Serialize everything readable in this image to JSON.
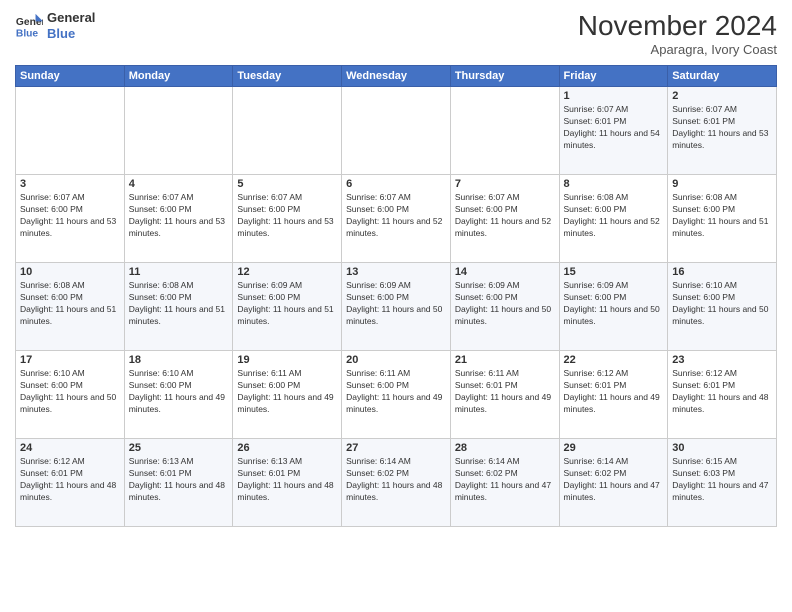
{
  "header": {
    "logo_line1": "General",
    "logo_line2": "Blue",
    "month": "November 2024",
    "location": "Aparagra, Ivory Coast"
  },
  "days_of_week": [
    "Sunday",
    "Monday",
    "Tuesday",
    "Wednesday",
    "Thursday",
    "Friday",
    "Saturday"
  ],
  "weeks": [
    [
      {
        "day": "",
        "info": ""
      },
      {
        "day": "",
        "info": ""
      },
      {
        "day": "",
        "info": ""
      },
      {
        "day": "",
        "info": ""
      },
      {
        "day": "",
        "info": ""
      },
      {
        "day": "1",
        "info": "Sunrise: 6:07 AM\nSunset: 6:01 PM\nDaylight: 11 hours and 54 minutes."
      },
      {
        "day": "2",
        "info": "Sunrise: 6:07 AM\nSunset: 6:01 PM\nDaylight: 11 hours and 53 minutes."
      }
    ],
    [
      {
        "day": "3",
        "info": "Sunrise: 6:07 AM\nSunset: 6:00 PM\nDaylight: 11 hours and 53 minutes."
      },
      {
        "day": "4",
        "info": "Sunrise: 6:07 AM\nSunset: 6:00 PM\nDaylight: 11 hours and 53 minutes."
      },
      {
        "day": "5",
        "info": "Sunrise: 6:07 AM\nSunset: 6:00 PM\nDaylight: 11 hours and 53 minutes."
      },
      {
        "day": "6",
        "info": "Sunrise: 6:07 AM\nSunset: 6:00 PM\nDaylight: 11 hours and 52 minutes."
      },
      {
        "day": "7",
        "info": "Sunrise: 6:07 AM\nSunset: 6:00 PM\nDaylight: 11 hours and 52 minutes."
      },
      {
        "day": "8",
        "info": "Sunrise: 6:08 AM\nSunset: 6:00 PM\nDaylight: 11 hours and 52 minutes."
      },
      {
        "day": "9",
        "info": "Sunrise: 6:08 AM\nSunset: 6:00 PM\nDaylight: 11 hours and 51 minutes."
      }
    ],
    [
      {
        "day": "10",
        "info": "Sunrise: 6:08 AM\nSunset: 6:00 PM\nDaylight: 11 hours and 51 minutes."
      },
      {
        "day": "11",
        "info": "Sunrise: 6:08 AM\nSunset: 6:00 PM\nDaylight: 11 hours and 51 minutes."
      },
      {
        "day": "12",
        "info": "Sunrise: 6:09 AM\nSunset: 6:00 PM\nDaylight: 11 hours and 51 minutes."
      },
      {
        "day": "13",
        "info": "Sunrise: 6:09 AM\nSunset: 6:00 PM\nDaylight: 11 hours and 50 minutes."
      },
      {
        "day": "14",
        "info": "Sunrise: 6:09 AM\nSunset: 6:00 PM\nDaylight: 11 hours and 50 minutes."
      },
      {
        "day": "15",
        "info": "Sunrise: 6:09 AM\nSunset: 6:00 PM\nDaylight: 11 hours and 50 minutes."
      },
      {
        "day": "16",
        "info": "Sunrise: 6:10 AM\nSunset: 6:00 PM\nDaylight: 11 hours and 50 minutes."
      }
    ],
    [
      {
        "day": "17",
        "info": "Sunrise: 6:10 AM\nSunset: 6:00 PM\nDaylight: 11 hours and 50 minutes."
      },
      {
        "day": "18",
        "info": "Sunrise: 6:10 AM\nSunset: 6:00 PM\nDaylight: 11 hours and 49 minutes."
      },
      {
        "day": "19",
        "info": "Sunrise: 6:11 AM\nSunset: 6:00 PM\nDaylight: 11 hours and 49 minutes."
      },
      {
        "day": "20",
        "info": "Sunrise: 6:11 AM\nSunset: 6:00 PM\nDaylight: 11 hours and 49 minutes."
      },
      {
        "day": "21",
        "info": "Sunrise: 6:11 AM\nSunset: 6:01 PM\nDaylight: 11 hours and 49 minutes."
      },
      {
        "day": "22",
        "info": "Sunrise: 6:12 AM\nSunset: 6:01 PM\nDaylight: 11 hours and 49 minutes."
      },
      {
        "day": "23",
        "info": "Sunrise: 6:12 AM\nSunset: 6:01 PM\nDaylight: 11 hours and 48 minutes."
      }
    ],
    [
      {
        "day": "24",
        "info": "Sunrise: 6:12 AM\nSunset: 6:01 PM\nDaylight: 11 hours and 48 minutes."
      },
      {
        "day": "25",
        "info": "Sunrise: 6:13 AM\nSunset: 6:01 PM\nDaylight: 11 hours and 48 minutes."
      },
      {
        "day": "26",
        "info": "Sunrise: 6:13 AM\nSunset: 6:01 PM\nDaylight: 11 hours and 48 minutes."
      },
      {
        "day": "27",
        "info": "Sunrise: 6:14 AM\nSunset: 6:02 PM\nDaylight: 11 hours and 48 minutes."
      },
      {
        "day": "28",
        "info": "Sunrise: 6:14 AM\nSunset: 6:02 PM\nDaylight: 11 hours and 47 minutes."
      },
      {
        "day": "29",
        "info": "Sunrise: 6:14 AM\nSunset: 6:02 PM\nDaylight: 11 hours and 47 minutes."
      },
      {
        "day": "30",
        "info": "Sunrise: 6:15 AM\nSunset: 6:03 PM\nDaylight: 11 hours and 47 minutes."
      }
    ]
  ]
}
